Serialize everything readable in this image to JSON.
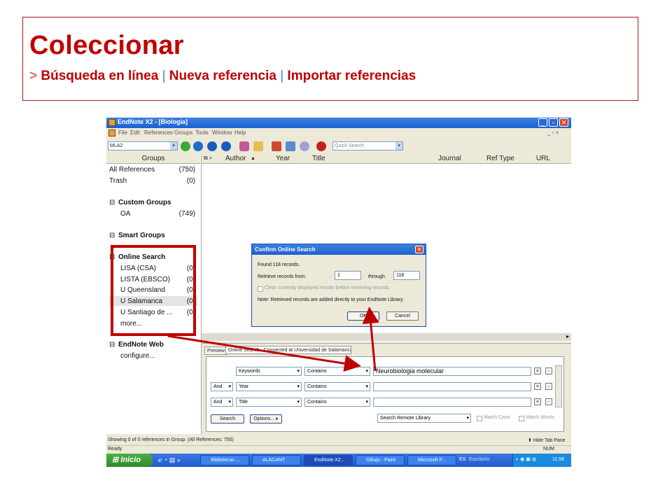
{
  "slide": {
    "title": "Coleccionar",
    "subtitle_arrow": ">",
    "subtitle_part1": "Búsqueda  en línea",
    "subtitle_sep": "|",
    "subtitle_part2": "Nueva referencia",
    "subtitle_part3": "Importar referencias"
  },
  "window": {
    "title": "EndNote X2 - [Biologia]",
    "minimize": "_",
    "maximize": "▫",
    "close": "✕"
  },
  "menu": [
    "File",
    "Edit",
    "References",
    "Groups",
    "Tools",
    "Window",
    "Help"
  ],
  "toolbar": {
    "style_value": "MLA2",
    "quick_search_placeholder": "Quick Search"
  },
  "groups": {
    "header": "Groups",
    "all_references": {
      "label": "All References",
      "count": "(750)"
    },
    "trash": {
      "label": "Trash",
      "count": "(0)"
    },
    "custom_groups": "Custom Groups",
    "oa": {
      "label": "OA",
      "count": "(749)"
    },
    "smart_groups": "Smart Groups",
    "online_search": "Online Search",
    "online_items": [
      {
        "label": "LISA (CSA)",
        "count": "(0)"
      },
      {
        "label": "LISTA (EBSCO)",
        "count": "(0)"
      },
      {
        "label": "U Queensland",
        "count": "(0)"
      },
      {
        "label": "U Salamanca",
        "count": "(0)"
      },
      {
        "label": "U Santiago de ...",
        "count": "(0)"
      }
    ],
    "more": "more...",
    "endnote_web": "EndNote Web",
    "configure": "configure...",
    "collapse_symbol": "⊟"
  },
  "columns": [
    "Author",
    "Year",
    "Title",
    "Journal",
    "Ref Type",
    "URL"
  ],
  "tabs": {
    "preview": "Preview",
    "online_search": "Online Search - Connected at Universidad de Salamanca"
  },
  "search_rows": [
    {
      "connector": "",
      "field": "Keywords",
      "op": "Contains",
      "value": "Neurobiologia molecular"
    },
    {
      "connector": "And",
      "field": "Year",
      "op": "Contains",
      "value": ""
    },
    {
      "connector": "And",
      "field": "Title",
      "op": "Contains",
      "value": ""
    }
  ],
  "search_controls": {
    "search_button": "Search",
    "options_button": "Options...",
    "library_select": "Search Remote Library",
    "match_case": "Match Case",
    "match_words": "Match Words",
    "plus": "+",
    "minus": "-"
  },
  "status": {
    "line1": "Showing 0 of 0 references in Group. (All References: 750)",
    "hide_tab": "Hide Tab Pane",
    "ready": "Ready",
    "num": "NUM"
  },
  "taskbar": {
    "start": "Inicio",
    "tasks": [
      "Bibliotecas ...",
      "ALACANT",
      "EndNote X2...",
      "Dibujo - Paint",
      "Microsoft P..."
    ],
    "lang": "ES",
    "desktop": "Escritorio",
    "time": "11:58"
  },
  "dialog": {
    "title": "Confirm Online Search",
    "found": "Found 118 records.",
    "retrieve_label": "Retrieve records from:",
    "from_value": "1",
    "through_label": "through",
    "to_value": "118",
    "clear_label": "Clear currently displayed results before retrieving records.",
    "note": "Note: Retrieved records are added directly to your EndNote Library.",
    "ok": "OK",
    "cancel": "Cancel"
  },
  "colors": {
    "accent_red": "#c00000",
    "xp_blue": "#245ad0"
  }
}
